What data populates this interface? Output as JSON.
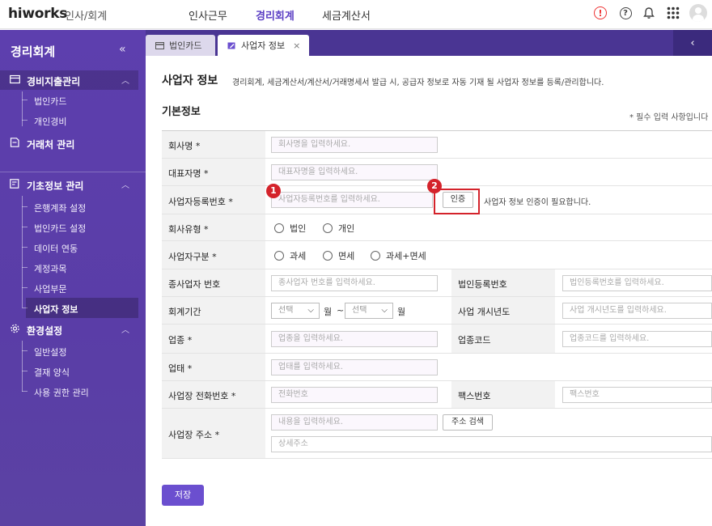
{
  "app": {
    "logo": "hiworks",
    "module": "인사/회계",
    "topnav": [
      "인사근무",
      "경리회계",
      "세금계산서"
    ],
    "active_topnav": "경리회계",
    "alert_glyph": "!",
    "help_glyph": "?",
    "accent_color": "#5b3fc4"
  },
  "sidebar": {
    "title": "경리회계",
    "collapse_glyph": "«",
    "groups": [
      {
        "label": "경비지출관리",
        "icon": "card-icon",
        "items": [
          "법인카드",
          "개인경비"
        ]
      },
      {
        "label": "거래처 관리",
        "icon": "document-icon",
        "items": []
      },
      {
        "label": "기초정보 관리",
        "icon": "document-edit-icon",
        "items": [
          "은행계좌 설정",
          "법인카드 설정",
          "데이터 연동",
          "계정과목",
          "사업부문",
          "사업자 정보"
        ]
      },
      {
        "label": "환경설정",
        "icon": "gear-icon",
        "items": [
          "일반설정",
          "결재 양식",
          "사용 권한 관리"
        ]
      }
    ],
    "active_item": "사업자 정보"
  },
  "tabs": [
    {
      "label": "법인카드",
      "icon": "card-icon"
    },
    {
      "label": "사업자 정보",
      "icon": "edit-icon",
      "close": "×"
    }
  ],
  "tab_scroll_glyph": "‹",
  "page": {
    "title": "사업자 정보",
    "description": "경리회계, 세금계산서/계산서/거래명세서 발급 시, 공급자 정보로 자동 기재 될 사업자 정보를 등록/관리합니다.",
    "section": "기본정보",
    "required_note": "* 필수 입력 사항입니다",
    "save_label": "저장"
  },
  "form": {
    "company_name": {
      "label": "회사명 *",
      "placeholder": "회사명을 입력하세요."
    },
    "ceo_name": {
      "label": "대표자명 *",
      "placeholder": "대표자명을 입력하세요."
    },
    "biz_reg_no": {
      "label": "사업자등록번호 *",
      "placeholder": "사업자등록번호를 입력하세요.",
      "verify_label": "인증",
      "verify_note": "사업자 정보 인증이 필요합니다."
    },
    "company_type": {
      "label": "회사유형 *",
      "options": [
        "법인",
        "개인"
      ]
    },
    "biz_class": {
      "label": "사업자구분 *",
      "options": [
        "과세",
        "면세",
        "과세+면세"
      ]
    },
    "sub_biz_no": {
      "label": "종사업자 번호",
      "placeholder": "종사업자 번호를 입력하세요."
    },
    "corp_reg_no": {
      "label": "법인등록번호",
      "placeholder": "법인등록번호를 입력하세요."
    },
    "fiscal_period": {
      "label": "회계기간",
      "select_placeholder": "선택",
      "month_unit": "월",
      "separator": "~"
    },
    "start_year": {
      "label": "사업 개시년도",
      "placeholder": "사업 개시년도를 입력하세요."
    },
    "industry": {
      "label": "업종 *",
      "placeholder": "업종을 입력하세요."
    },
    "industry_code": {
      "label": "업종코드",
      "placeholder": "업종코드를 입력하세요."
    },
    "business_type": {
      "label": "업태 *",
      "placeholder": "업태를 입력하세요."
    },
    "phone": {
      "label": "사업장 전화번호 *",
      "placeholder": "전화번호"
    },
    "fax": {
      "label": "팩스번호",
      "placeholder": "팩스번호"
    },
    "address": {
      "label": "사업장 주소 *",
      "placeholder": "내용을 입력하세요.",
      "search_label": "주소 검색",
      "detail_placeholder": "상세주소"
    }
  },
  "annotations": [
    "1",
    "2"
  ]
}
